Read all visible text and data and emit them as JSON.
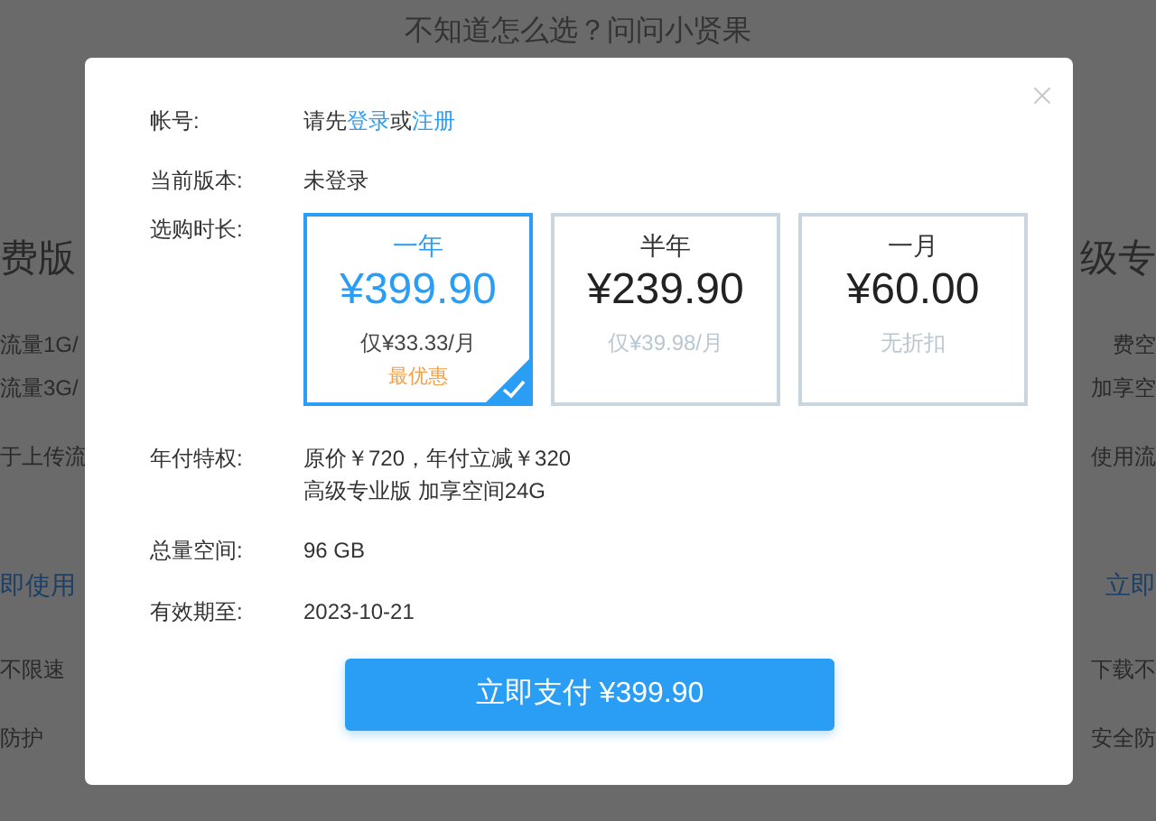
{
  "background": {
    "heading": "不知道怎么选？问问小贤果",
    "left_column": [
      {
        "kind": "title",
        "text": "费版"
      },
      {
        "kind": "text",
        "text": "流量1G/"
      },
      {
        "kind": "text",
        "text": "流量3G/"
      },
      {
        "kind": "text",
        "text": "于上传流"
      },
      {
        "kind": "link",
        "text": "即使用"
      },
      {
        "kind": "text",
        "text": "不限速"
      },
      {
        "kind": "text",
        "text": "防护"
      }
    ],
    "right_column": [
      {
        "kind": "title",
        "text": "级专"
      },
      {
        "kind": "text",
        "text": "费空"
      },
      {
        "kind": "text",
        "text": "加享空"
      },
      {
        "kind": "text",
        "text": "使用流"
      },
      {
        "kind": "link",
        "text": "立即"
      },
      {
        "kind": "text",
        "text": "下载不"
      },
      {
        "kind": "text",
        "text": "安全防"
      }
    ]
  },
  "dialog": {
    "account": {
      "label": "帐号:",
      "value": [
        {
          "kind": "text",
          "text": "请先"
        },
        {
          "kind": "link",
          "text": "登录"
        },
        {
          "kind": "text",
          "text": "或"
        },
        {
          "kind": "link",
          "text": "注册"
        }
      ]
    },
    "version": {
      "label": "当前版本:",
      "value": "未登录"
    },
    "duration": {
      "label": "选购时长:",
      "options": [
        {
          "period": "一年",
          "price": "¥399.90",
          "per_month": "仅¥33.33/月",
          "note": "最优惠",
          "selected": true
        },
        {
          "period": "半年",
          "price": "¥239.90",
          "per_month": "仅¥39.98/月",
          "selected": false
        },
        {
          "period": "一月",
          "price": "¥60.00",
          "per_month": "无折扣",
          "selected": false
        }
      ]
    },
    "privilege": {
      "label": "年付特权:",
      "lines": [
        "原价￥720，年付立减￥320",
        "高级专业版 加享空间24G"
      ]
    },
    "total": {
      "label": "总量空间:",
      "value": "96 GB"
    },
    "expiry": {
      "label": "有效期至:",
      "value": "2023-10-21"
    },
    "pay_button": "立即支付 ¥399.90"
  }
}
